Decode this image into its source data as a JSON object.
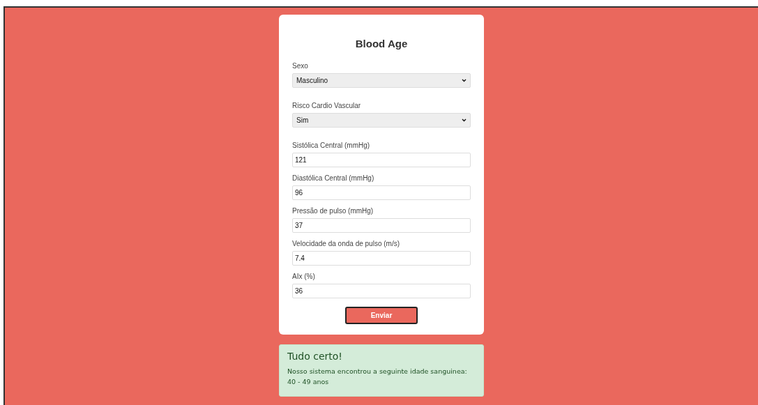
{
  "form": {
    "title": "Blood Age",
    "fields": [
      {
        "kind": "select",
        "label": "Sexo",
        "value": "Masculino"
      },
      {
        "kind": "select",
        "label": "Risco Cardio Vascular",
        "value": "Sim"
      },
      {
        "kind": "input",
        "label": "Sistólica Central (mmHg)",
        "value": "121"
      },
      {
        "kind": "input",
        "label": "Diastólica Central (mmHg)",
        "value": "96"
      },
      {
        "kind": "input",
        "label": "Pressão de pulso (mmHg)",
        "value": "37"
      },
      {
        "kind": "input",
        "label": "Velocidade da onda de pulso (m/s)",
        "value": "7.4"
      },
      {
        "kind": "input",
        "label": "AIx (%)",
        "value": "36"
      }
    ],
    "submit": "Enviar"
  },
  "alert": {
    "title": "Tudo certo!",
    "message": "Nosso sistema encontrou a seguinte idade sanguinea: 40 - 49 anos"
  }
}
